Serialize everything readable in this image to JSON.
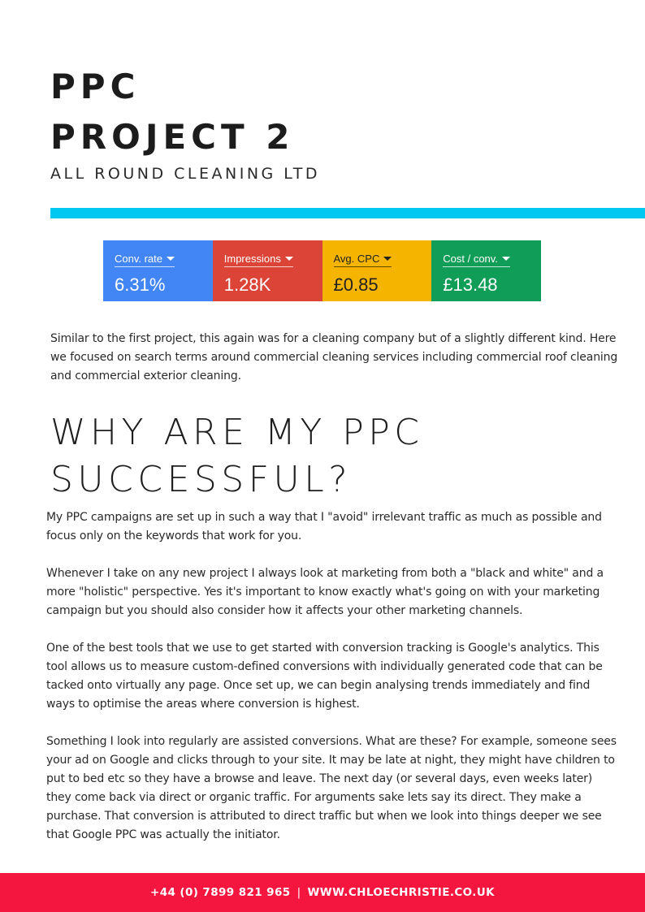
{
  "header": {
    "title_line1": "PPC",
    "title_line2": "PROJECT 2",
    "subtitle": "ALL ROUND CLEANING LTD",
    "rule_color": "#00c8f0"
  },
  "metrics": [
    {
      "label": "Conv. rate",
      "value": "6.31%",
      "color": "#4285f4"
    },
    {
      "label": "Impressions",
      "value": "1.28K",
      "color": "#db4437"
    },
    {
      "label": "Avg. CPC",
      "value": "£0.85",
      "color": "#f4b400"
    },
    {
      "label": "Cost / conv.",
      "value": "£13.48",
      "color": "#0f9d58"
    }
  ],
  "intro": "Similar to the first project, this again was for a cleaning company but of a slightly different kind. Here we focused on search terms around commercial cleaning services including commercial roof cleaning and commercial exterior cleaning.",
  "section": {
    "heading": "WHY ARE MY PPC SUCCESSFUL?",
    "paragraphs": [
      "My PPC campaigns are set up in such a way that I \"avoid\" irrelevant traffic as much as possible and focus only on the keywords that work for you.",
      "Whenever I take on any new project I always look at marketing from both a \"black and white\" and a more \"holistic\"  perspective. Yes it's important to know exactly what's going on with your marketing campaign but you should also consider how it affects your other marketing channels.",
      "One of the best tools that we use to get started with conversion tracking is Google's analytics. This tool allows us to measure custom-defined conversions with individually generated code that can be tacked onto virtually any page. Once set up, we can begin analysing trends immediately and find ways to optimise the areas where conversion is highest.",
      "Something I look into regularly are assisted conversions. What are these? For example, someone sees your ad on Google and clicks through to your site. It may be late at night, they might have children to put to bed etc so they have a browse and leave. The next day (or several days, even weeks later) they come back via direct or organic traffic. For arguments sake lets say its direct. They make a purchase. That conversion is attributed to direct traffic but when we look into things deeper we see that Google PPC was actually the initiator."
    ]
  },
  "footer": {
    "phone": "+44 (0) 7899 821 965",
    "separator": "|",
    "website": "WWW.CHLOECHRISTIE.CO.UK",
    "color": "#f4163e"
  }
}
